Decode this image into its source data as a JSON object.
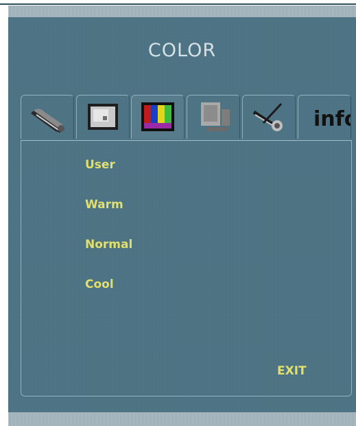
{
  "osd": {
    "title": "COLOR",
    "tabs": [
      {
        "icon": "brightness-contrast-icon"
      },
      {
        "icon": "image-position-icon"
      },
      {
        "icon": "color-icon",
        "active": true
      },
      {
        "icon": "monitor-setup-icon"
      },
      {
        "icon": "tools-icon"
      },
      {
        "icon": "info-icon",
        "label": "info"
      }
    ],
    "menu_items": [
      "User",
      "Warm",
      "Normal",
      "Cool"
    ],
    "exit_label": "EXIT"
  },
  "colors": {
    "background": "#4a7486",
    "text_title": "#d6e1e6",
    "text_item": "#e2e06a",
    "border": "#8fb0bd"
  }
}
